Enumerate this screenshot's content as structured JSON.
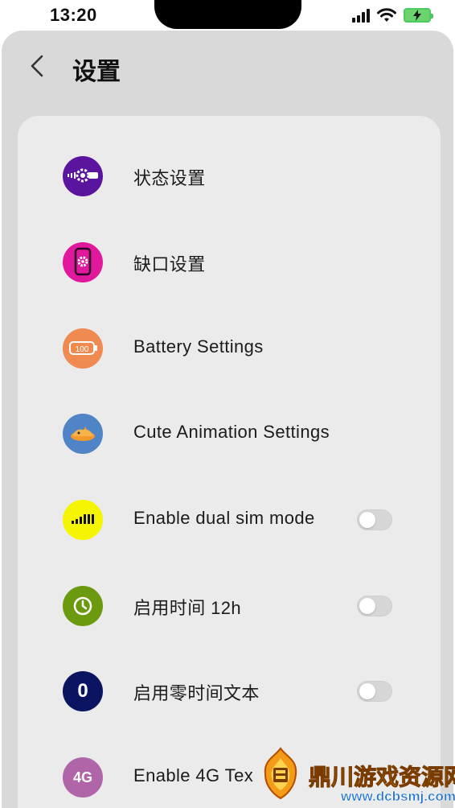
{
  "status_bar": {
    "time": "13:20",
    "icons": [
      "signal-icon",
      "wifi-icon",
      "battery-charging-icon"
    ]
  },
  "header": {
    "title": "设置",
    "back_icon": "chevron-left-icon"
  },
  "settings": [
    {
      "label": "状态设置",
      "icon": "status-bar-gear-icon",
      "icon_color": "#5a149e",
      "has_toggle": false
    },
    {
      "label": "缺口设置",
      "icon": "phone-gear-icon",
      "icon_color": "#e0189c",
      "has_toggle": false
    },
    {
      "label": "Battery Settings",
      "icon": "battery-icon",
      "icon_color": "#ef8a50",
      "icon_text": "100",
      "has_toggle": false
    },
    {
      "label": "Cute Animation Settings",
      "icon": "cute-animation-icon",
      "icon_color": "#4f84c6",
      "has_toggle": false
    },
    {
      "label": "Enable dual sim mode",
      "icon": "dual-sim-signal-icon",
      "icon_color": "#f5f500",
      "has_toggle": true,
      "toggle_on": false
    },
    {
      "label": "启用时间 12h",
      "icon": "clock-icon",
      "icon_color": "#6b9a0e",
      "has_toggle": true,
      "toggle_on": false
    },
    {
      "label": "启用零时间文本",
      "icon": "zero-icon",
      "icon_color": "#0b1460",
      "icon_text": "0",
      "has_toggle": true,
      "toggle_on": false
    },
    {
      "label": "Enable 4G Tex",
      "icon": "4g-icon",
      "icon_color": "#b065a8",
      "icon_text": "4G",
      "has_toggle": false
    }
  ],
  "watermark": {
    "title": "鼎川游戏资源网",
    "url": "www.dcbsmj.com"
  }
}
